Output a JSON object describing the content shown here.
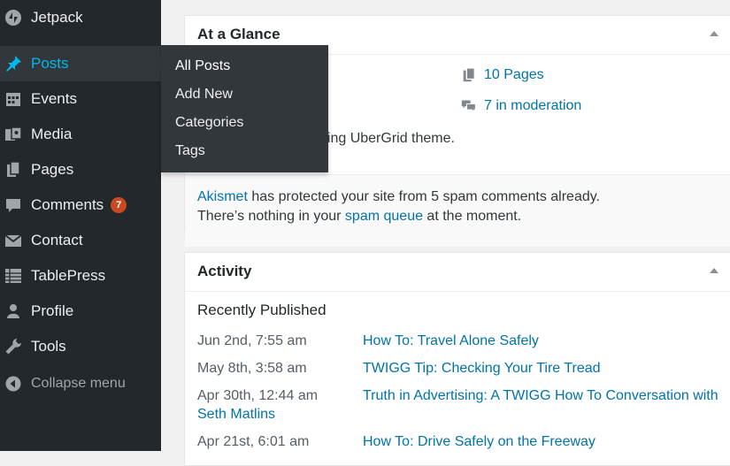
{
  "sidebar": {
    "items": [
      {
        "label": "Jetpack",
        "icon": "jetpack-icon"
      },
      {
        "label": "Posts",
        "icon": "pin-icon",
        "active": true
      },
      {
        "label": "Events",
        "icon": "calendar-icon"
      },
      {
        "label": "Media",
        "icon": "media-icon"
      },
      {
        "label": "Pages",
        "icon": "pages-icon"
      },
      {
        "label": "Comments",
        "icon": "comment-icon",
        "badge": "7"
      },
      {
        "label": "Contact",
        "icon": "envelope-icon"
      },
      {
        "label": "TablePress",
        "icon": "table-icon"
      },
      {
        "label": "Profile",
        "icon": "user-icon"
      },
      {
        "label": "Tools",
        "icon": "wrench-icon"
      }
    ],
    "collapse_label": "Collapse menu"
  },
  "posts_submenu": {
    "items": [
      "All Posts",
      "Add New",
      "Categories",
      "Tags"
    ]
  },
  "at_a_glance": {
    "title": "At a Glance",
    "pages": "10 Pages",
    "moderation": "7 in moderation",
    "theme_partial": "hing UberGrid theme.",
    "akismet_link": "Akismet",
    "akismet_text": " has protected your site from 5 spam comments already.",
    "spam_prefix": "There’s nothing in your ",
    "spam_link": "spam queue",
    "spam_suffix": " at the moment."
  },
  "activity": {
    "title": "Activity",
    "section_title": "Recently Published",
    "rows": [
      {
        "date": "Jun 2nd, 7:55 am",
        "title": "How To: Travel Alone Safely"
      },
      {
        "date": "May 8th, 3:58 am",
        "title": "TWIGG Tip: Checking Your Tire Tread"
      },
      {
        "date": "Apr 30th, 12:44 am",
        "title": "Truth in Advertising: A TWIGG How To Conversation with",
        "title_cont": "Seth Matlins"
      },
      {
        "date": "Apr 21st, 6:01 am",
        "title": "How To: Drive Safely on the Freeway"
      }
    ]
  },
  "colors": {
    "sidebar_bg": "#23282d",
    "active_blue": "#00b9eb",
    "link_blue": "#0073aa",
    "badge_red": "#ca4a1f"
  }
}
